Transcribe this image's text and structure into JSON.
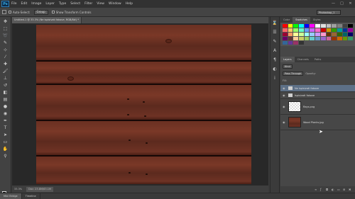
{
  "app": {
    "logo": "Ps",
    "menus": [
      "File",
      "Edit",
      "Image",
      "Layer",
      "Type",
      "Select",
      "Filter",
      "View",
      "Window",
      "Help"
    ],
    "window_controls": [
      "—",
      "□",
      "✕"
    ]
  },
  "options": {
    "auto_select": "Auto-Select:",
    "group": "Group",
    "transform": "Show Transform Controls",
    "workspace": "Photoshop_1"
  },
  "document": {
    "tab_title": "Untitled-1 @ 33.3% (Ne ispisivati fakove, RGB/8#) *",
    "zoom": "33.3%",
    "doc_info": "Doc: 23.8M/63.1M"
  },
  "panels": {
    "swatches_tabs": [
      "Color",
      "Swatches",
      "Styles"
    ],
    "active_swatch_tab": "Swatches",
    "layer_tabs": [
      "Layers",
      "Channels",
      "Paths"
    ],
    "kind": "Kind",
    "blend": "Pass Through",
    "opacity_label": "Opacity:",
    "fill_label": "Fill:",
    "layers": [
      {
        "name": "Ne ispisivati fakove",
        "type": "group",
        "selected": true
      },
      {
        "name": "Ispisivati fakove",
        "type": "group",
        "selected": false
      },
      {
        "name": "Rays.png",
        "type": "checker",
        "selected": false
      },
      {
        "name": "Wood Planks.jpg",
        "type": "wood",
        "selected": false
      }
    ]
  },
  "bottom_tabs": [
    "Mini Bridge",
    "Timeline"
  ],
  "swatch_colors": [
    "#ff0000",
    "#ffff00",
    "#00ff00",
    "#00ffff",
    "#0000ff",
    "#ff00ff",
    "#ffffff",
    "#e0e0e0",
    "#c0c0c0",
    "#a0a0a0",
    "#808080",
    "#404040",
    "#000000",
    "#ff6666",
    "#ffcc66",
    "#99ff66",
    "#66ffcc",
    "#6699ff",
    "#cc66ff",
    "#ff66cc",
    "#cc0000",
    "#cc9900",
    "#339900",
    "#009999",
    "#003399",
    "#990099",
    "#990033",
    "#ff9966",
    "#ffff99",
    "#ccff99",
    "#99ffff",
    "#99ccff",
    "#cc99ff",
    "#ff99cc",
    "#663300",
    "#996633",
    "#336600",
    "#006666",
    "#000066",
    "#660066",
    "#663333",
    "#ffcc99",
    "#cccc66",
    "#99cc66",
    "#66cccc",
    "#6699cc",
    "#9966cc",
    "#cc6699",
    "#993300",
    "#cc6600",
    "#669900",
    "#339966",
    "#336699",
    "#663399",
    "#993366",
    "#333333"
  ]
}
